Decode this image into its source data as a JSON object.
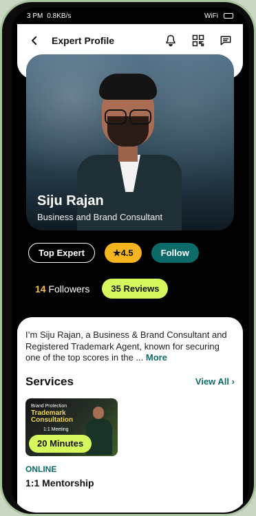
{
  "status": {
    "time_left": "3 PM",
    "speed": "0.8KB/s",
    "network": "WiFi"
  },
  "header": {
    "title": "Expert Profile",
    "back_icon": "back-arrow-icon",
    "bell_icon": "bell-icon",
    "qr_icon": "qr-code-icon",
    "chat_icon": "chat-icon"
  },
  "profile": {
    "name": "Siju Rajan",
    "role": "Business and Brand Consultant"
  },
  "actions": {
    "badge": "Top Expert",
    "rating": "★4.5",
    "follow": "Follow"
  },
  "stats": {
    "followers_count": "14",
    "followers_label": "Followers",
    "reviews": "35 Reviews"
  },
  "bio": {
    "text": "I’m Siju Rajan, a Business & Brand Consultant and Registered Trademark Agent, known for securing one of the top scores in the ...",
    "more": "More"
  },
  "services": {
    "title": "Services",
    "view_all": "View All",
    "card": {
      "kicker": "Brand Protection",
      "title_line_1": "Trademark",
      "title_line_2": "Consultation",
      "sub": "1:1 Meeting",
      "duration": "20 Minutes",
      "mode": "ONLINE",
      "name": "1:1 Mentorship"
    }
  }
}
